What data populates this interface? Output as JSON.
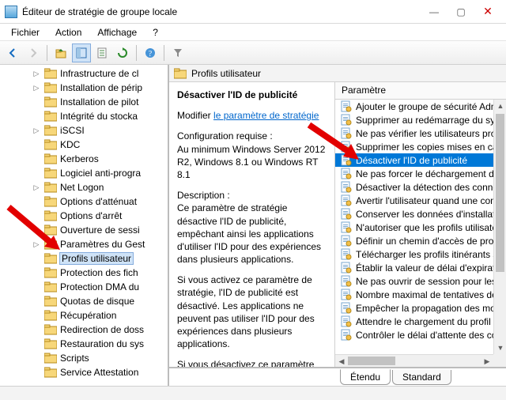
{
  "window": {
    "title": "Éditeur de stratégie de groupe locale"
  },
  "menu": {
    "file": "Fichier",
    "action": "Action",
    "view": "Affichage",
    "help": "?"
  },
  "tree": {
    "items": [
      {
        "label": "Infrastructure de cl",
        "expander": "▷"
      },
      {
        "label": "Installation de périp",
        "expander": "▷"
      },
      {
        "label": "Installation de pilot",
        "expander": ""
      },
      {
        "label": "Intégrité du stocka",
        "expander": ""
      },
      {
        "label": "iSCSI",
        "expander": "▷"
      },
      {
        "label": "KDC",
        "expander": ""
      },
      {
        "label": "Kerberos",
        "expander": ""
      },
      {
        "label": "Logiciel anti-progra",
        "expander": ""
      },
      {
        "label": "Net Logon",
        "expander": "▷"
      },
      {
        "label": "Options d'atténuat",
        "expander": ""
      },
      {
        "label": "Options d'arrêt",
        "expander": ""
      },
      {
        "label": "Ouverture de sessi",
        "expander": ""
      },
      {
        "label": "Paramètres du Gest",
        "expander": "▷"
      },
      {
        "label": "Profils utilisateur",
        "expander": "",
        "selected": true
      },
      {
        "label": "Protection des fich",
        "expander": ""
      },
      {
        "label": "Protection DMA du",
        "expander": ""
      },
      {
        "label": "Quotas de disque",
        "expander": ""
      },
      {
        "label": "Récupération",
        "expander": ""
      },
      {
        "label": "Redirection de doss",
        "expander": ""
      },
      {
        "label": "Restauration du sys",
        "expander": ""
      },
      {
        "label": "Scripts",
        "expander": ""
      },
      {
        "label": "Service Attestation",
        "expander": ""
      }
    ]
  },
  "right_header": {
    "title": "Profils utilisateur"
  },
  "detail": {
    "selected_title": "Désactiver l'ID de publicité",
    "modify_label": "Modifier",
    "modify_link": "le paramètre de stratégie",
    "requirements_label": "Configuration requise :",
    "requirements_text": "Au minimum Windows Server 2012 R2, Windows 8.1 ou Windows RT 8.1",
    "description_label": "Description :",
    "description_p1": "Ce paramètre de stratégie désactive l'ID de publicité, empêchant ainsi les applications d'utiliser l'ID pour des expériences dans plusieurs applications.",
    "description_p2": "Si vous activez ce paramètre de stratégie, l'ID de publicité est désactivé. Les applications ne peuvent pas utiliser l'ID pour des expériences dans plusieurs applications.",
    "description_p3": "Si vous désactivez ce paramètre de"
  },
  "list": {
    "header": "Paramètre",
    "items": [
      {
        "label": "Ajouter le groupe de sécurité Admin"
      },
      {
        "label": "Supprimer au redémarrage du systèm"
      },
      {
        "label": "Ne pas vérifier les utilisateurs proprié"
      },
      {
        "label": "Supprimer les copies mises en cache"
      },
      {
        "label": "Désactiver l'ID de publicité",
        "selected": true
      },
      {
        "label": "Ne pas forcer le déchargement du R"
      },
      {
        "label": "Désactiver la détection des connexio"
      },
      {
        "label": "Avertir l'utilisateur quand une conne"
      },
      {
        "label": "Conserver les données d'installation"
      },
      {
        "label": "N'autoriser que les profils utilisateur"
      },
      {
        "label": "Définir un chemin d'accès de profil it"
      },
      {
        "label": "Télécharger les profils itinérants sur"
      },
      {
        "label": "Établir la valeur de délai d'expiration"
      },
      {
        "label": "Ne pas ouvrir de session pour les util"
      },
      {
        "label": "Nombre maximal de tentatives de d"
      },
      {
        "label": "Empêcher la propagation des modifi"
      },
      {
        "label": "Attendre le chargement du profil util"
      },
      {
        "label": "Contrôler le délai d'attente des conte"
      }
    ]
  },
  "tabs": {
    "extended": "Étendu",
    "standard": "Standard"
  }
}
